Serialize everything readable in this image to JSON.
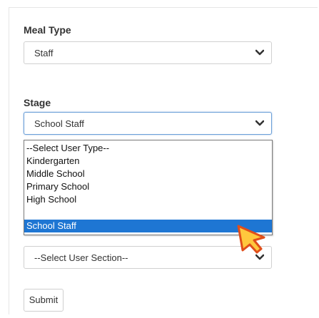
{
  "form": {
    "meal_type": {
      "label": "Meal Type",
      "value": "Staff"
    },
    "stage": {
      "label": "Stage",
      "value": "School Staff",
      "options": [
        "--Select User Type--",
        "Kindergarten",
        "Middle School",
        "Primary School",
        "High School",
        "School Staff"
      ],
      "selected_option": "School Staff"
    },
    "section": {
      "value": "--Select User Section--"
    },
    "submit_label": "Submit"
  },
  "icons": {
    "select_arrow": "chevron-down-icon",
    "cursor": "pointer-cursor-icon"
  },
  "colors": {
    "selected_option_bg": "#1e76d3",
    "cursor_fill": "#ffc83d",
    "cursor_stroke": "#e04e1a"
  }
}
